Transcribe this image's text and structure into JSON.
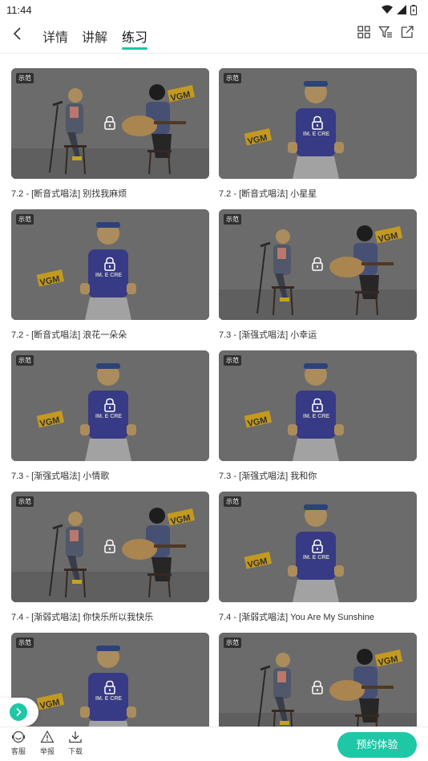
{
  "status": {
    "time": "11:44"
  },
  "nav": {
    "tabs": [
      "详情",
      "讲解",
      "练习"
    ],
    "active_tab": 2
  },
  "badge_label": "示范",
  "cards": [
    {
      "title": "7.2 - [断音式唱法] 别找我麻烦",
      "scene": "duo"
    },
    {
      "title": "7.2 - [断音式唱法] 小星星",
      "scene": "solo"
    },
    {
      "title": "7.2 - [断音式唱法] 浪花一朵朵",
      "scene": "solo"
    },
    {
      "title": "7.3 - [渐强式唱法] 小幸运",
      "scene": "duo"
    },
    {
      "title": "7.3 - [渐强式唱法] 小情歌",
      "scene": "solo"
    },
    {
      "title": "7.3 - [渐强式唱法] 我和你",
      "scene": "solo"
    },
    {
      "title": "7.4 - [渐弱式唱法] 你快乐所以我快乐",
      "scene": "duo"
    },
    {
      "title": "7.4 - [渐弱式唱法] You Are My Sunshine",
      "scene": "solo"
    },
    {
      "title": "",
      "scene": "solo"
    },
    {
      "title": "",
      "scene": "duo"
    }
  ],
  "bottom": {
    "service": "客服",
    "report": "举报",
    "download": "下载",
    "cta": "预约体验"
  },
  "colors": {
    "accent": "#1ec7a6",
    "sign": "#e6b21e",
    "shirt": "#3b3f9a"
  }
}
